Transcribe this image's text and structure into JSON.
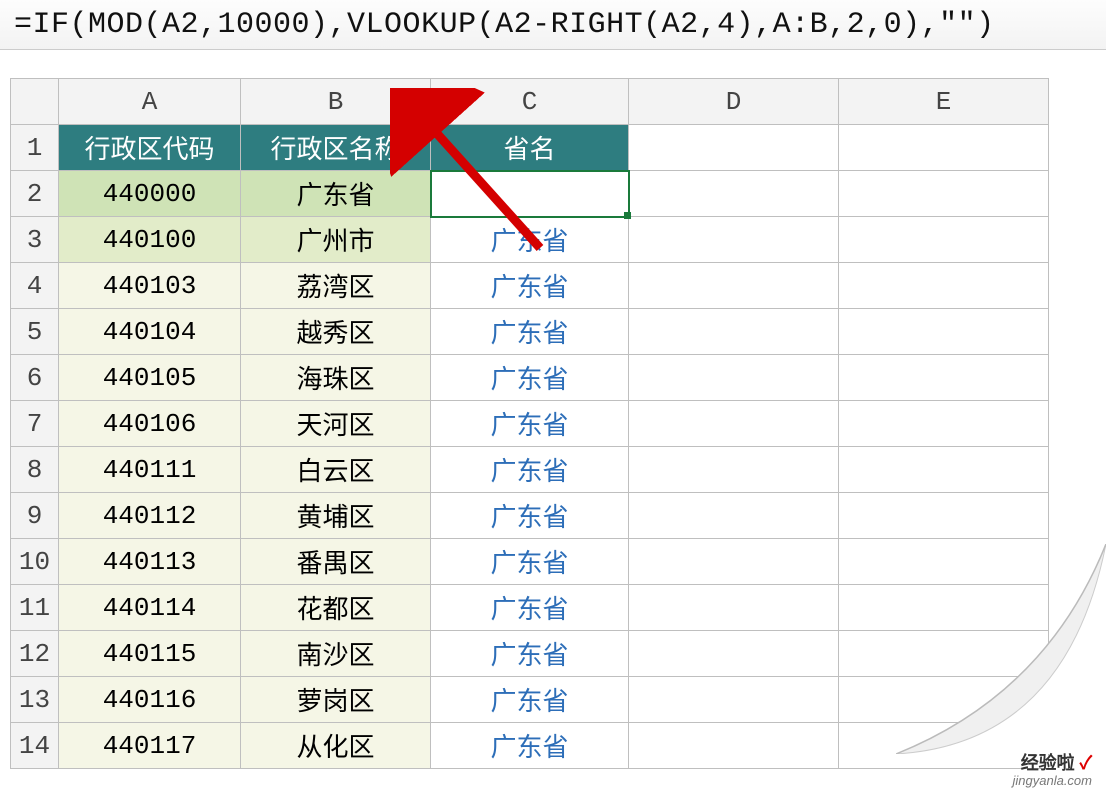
{
  "formula_bar": "=IF(MOD(A2,10000),VLOOKUP(A2-RIGHT(A2,4),A:B,2,0),\"\")",
  "columns": [
    "A",
    "B",
    "C",
    "D",
    "E"
  ],
  "header_row": {
    "a": "行政区代码",
    "b": "行政区名称",
    "c": "省名"
  },
  "rows": [
    {
      "n": "1"
    },
    {
      "n": "2",
      "a": "440000",
      "b": "广东省",
      "c": ""
    },
    {
      "n": "3",
      "a": "440100",
      "b": "广州市",
      "c": "广东省"
    },
    {
      "n": "4",
      "a": "440103",
      "b": "荔湾区",
      "c": "广东省"
    },
    {
      "n": "5",
      "a": "440104",
      "b": "越秀区",
      "c": "广东省"
    },
    {
      "n": "6",
      "a": "440105",
      "b": "海珠区",
      "c": "广东省"
    },
    {
      "n": "7",
      "a": "440106",
      "b": "天河区",
      "c": "广东省"
    },
    {
      "n": "8",
      "a": "440111",
      "b": "白云区",
      "c": "广东省"
    },
    {
      "n": "9",
      "a": "440112",
      "b": "黄埔区",
      "c": "广东省"
    },
    {
      "n": "10",
      "a": "440113",
      "b": "番禺区",
      "c": "广东省"
    },
    {
      "n": "11",
      "a": "440114",
      "b": "花都区",
      "c": "广东省"
    },
    {
      "n": "12",
      "a": "440115",
      "b": "南沙区",
      "c": "广东省"
    },
    {
      "n": "13",
      "a": "440116",
      "b": "萝岗区",
      "c": "广东省"
    },
    {
      "n": "14",
      "a": "440117",
      "b": "从化区",
      "c": "广东省"
    }
  ],
  "watermark": {
    "line1": "经验啦",
    "check": "✓",
    "line2": "jingyanla.com"
  }
}
